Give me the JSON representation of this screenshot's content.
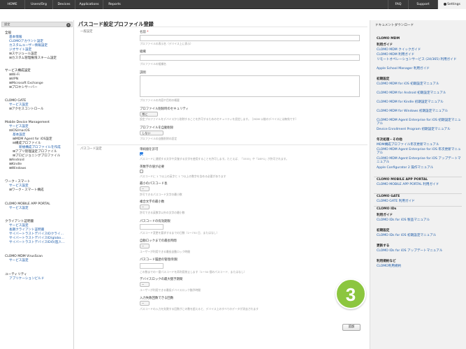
{
  "topnav": {
    "items": [
      "HOME",
      "Users/Org",
      "Devices",
      "Applications",
      "Reports",
      "FAQ",
      "Support",
      "Settings"
    ]
  },
  "sidebar": {
    "header": "設定",
    "collapse": "«",
    "lines": [
      "全般",
      "基本情報",
      "CLOMOアカウント設定",
      "カスタムユーザー情報設定",
      "ジオサイト設定",
      "⊞スケジュール設定",
      "⊞カスタム管理権限スキーム設定",
      "サービス構成設定",
      "⊞Wi-Fi",
      "⊞VPN",
      "⊞Microsoft Exchange",
      "⊞プロキシサーバー",
      "CLOMO GATE",
      "サービス設定",
      "⊞アクセスコントロール",
      "Mobile Device Management",
      "サービス設定",
      "⊟iOS/macOS",
      "基本設定",
      "⊞MDM Agent for iOS設定",
      "⊟構成プロファイル",
      "新規構成プロファイルを作成",
      "⊞アプリ管理設定プロファイル",
      "⊞プロビジョニングプロファイル",
      "⊞Android",
      "⊞Kindle",
      "⊞Windows",
      "ワーク・スマート",
      "サービス設定",
      "⊞ワーク・スマート構成",
      "CLOMO MOBILE APP PORTAL",
      "サービス設定",
      "クライアント証明書",
      "サービス設定",
      "長期クライアント証明書",
      "サイバートラストデバイスIDクライ…",
      "サイバートラストデバイスID(globo…",
      "サイバートラストデバイスIDの(医人…",
      "CLOMO MDM VirusScan",
      "サービス設定",
      "ユーティリティ",
      "アプリケーションビルド"
    ]
  },
  "main": {
    "title": "パスコード設定プロファイル登録",
    "section_general": "一般設定",
    "name_label": "名前",
    "name_req": "*",
    "name_hint": "プロファイルの表示名（デバイス上に表示）",
    "org_label": "組織",
    "org_hint": "プロファイルの組織名",
    "desc_label": "説明",
    "desc_hint": "プロファイルの内容や目的の概要",
    "security_label": "プロファイル削除時のセキュリティ",
    "security_value": "常に",
    "security_hint": "設定プロファイルをデバイスから削除することを許可するためのセキュリティを設定します。［MDM 以後のデバイスには無効です］",
    "autoremove_label": "プロファイルを自動削除",
    "autoremove_value": "しない",
    "autoremove_hint": "プロファイルの自動削除の設定",
    "section_passcode": "パスコード設定",
    "f1_label": "単純値を許可",
    "f1_hint": "パスコードに連続する文字や反復する文字を使用することを許可します。たとえば、「3333」や「DEFG」が許可されます。",
    "f2_label": "英数字の値が必要",
    "f2_hint": "パスコードに 1 つ以上の英字と 1 つ以上の数字を含める必要があります",
    "f3_label": "最小のパスコード長",
    "f3_value": "--",
    "f3_hint": "許可できるパスコード文字の最小数",
    "f4_label": "複合文字の最小数",
    "f4_value": "--",
    "f4_hint": "許可できる英数字以外の文字の最小数",
    "f5_label": "パスコードの有効期限",
    "f5_hint": "パスコード変更を要求するまでの日数（1〜730 日、またはなし）",
    "f6_label": "自動ロックまでの最長時間",
    "f6_value": "--",
    "f6_hint": "ユーザーが利用できる最長自動ロック時間",
    "f7_label": "パスコード履歴の管理/制限",
    "f7_hint": "この数までの一意パスコードを再利用禁止します（1〜50 個のパスコード、またはなし）",
    "f8_label": "デバイスロックの最大猶予期間",
    "f8_value": "--",
    "f8_hint": "ユーザーが利用できる最長デバイスロック猶予時間",
    "f9_label": "入力失敗回数できる回数",
    "f9_value": "--",
    "f9_hint": "パスコードの入力を失敗する回数がこの数を超えると、デバイス上のすべてのデータが消去されます",
    "add_button": "追加",
    "step_badge": "3"
  },
  "right": {
    "title": "ドキュメントダウンロード",
    "sections": [
      {
        "head": "CLOMO MDM"
      },
      {
        "sub": "利用ガイド"
      },
      {
        "link": "CLOMO MDM クイックガイド"
      },
      {
        "link": "CLOMO MDM 利用ガイド"
      },
      {
        "link": "リモートオペレーションサービス (24/365) 利用ガイド"
      },
      {
        "link": "Apple School Manager 利用ガイド"
      },
      {
        "sub": "初期設定"
      },
      {
        "link": "CLOMO MDM for iOS 初期設定マニュアル"
      },
      {
        "link": "CLOMO MDM for Android 初期設定マニュアル"
      },
      {
        "link": "CLOMO MDM for Kindle 初期設定マニュアル"
      },
      {
        "link": "CLOMO MDM for Windows 初期設定マニュアル"
      },
      {
        "link": "CLOMO MDM Agent Enterprise for iOS 初期設定マニュアル"
      },
      {
        "link": "Device Enrollment Program 初期設定マニュアル"
      },
      {
        "sub": "年次処理・その他"
      },
      {
        "link": "MDM構成プロファイル年次更新マニュアル"
      },
      {
        "link": "CLOMO MDM Agent Enterprise for iOS 年次更新マニュアル"
      },
      {
        "link": "CLOMO MDM Agent Enterprise for iOS アップデートマニュアル"
      },
      {
        "link": "Apple Configurator 2 操作マニュアル"
      },
      {
        "head": "CLOMO MOBILE APP PORTAL"
      },
      {
        "link": "CLOMO MOBILE APP PORTAL 利用ガイド"
      },
      {
        "head": "CLOMO GATE"
      },
      {
        "link": "CLOMO GATE 利用ガイド"
      },
      {
        "head": "CLOMO IDs"
      },
      {
        "sub": "利用ガイド"
      },
      {
        "link": "CLOMO IDs for iOS 製品マニュアル"
      },
      {
        "sub": "初期設定"
      },
      {
        "link": "CLOMO IDs for iOS 初期設定マニュアル"
      },
      {
        "sub": "更新する"
      },
      {
        "link": "CLOMO IDs for iOS アップデートマニュアル"
      },
      {
        "sub": "利用規約など"
      },
      {
        "link": "CLOMO利用規約"
      }
    ]
  }
}
